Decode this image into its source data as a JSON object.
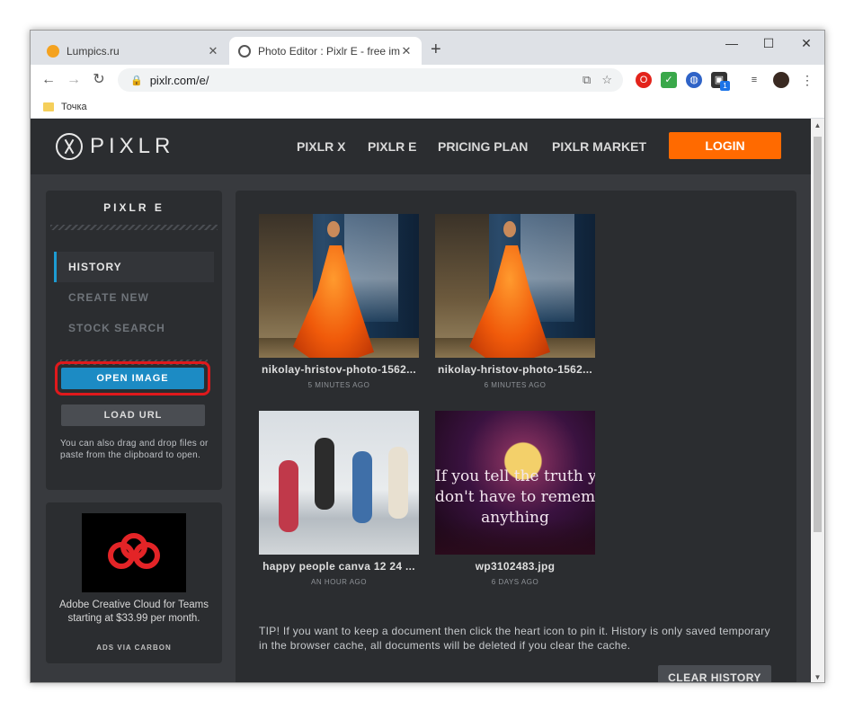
{
  "browser": {
    "tabs": [
      {
        "title": "Lumpics.ru",
        "active": false
      },
      {
        "title": "Photo Editor : Pixlr E - free image",
        "active": true
      }
    ],
    "address": "pixlr.com/e/",
    "bookmark": "Точка",
    "extension_badge": "1"
  },
  "header": {
    "logo": "PIXLR",
    "nav": [
      "PIXLR X",
      "PIXLR E",
      "PRICING PLAN",
      "PIXLR MARKET"
    ],
    "login": "LOGIN"
  },
  "sidebar": {
    "title": "PIXLR E",
    "items": [
      {
        "label": "HISTORY",
        "active": true
      },
      {
        "label": "CREATE NEW",
        "active": false
      },
      {
        "label": "STOCK SEARCH",
        "active": false
      }
    ],
    "open_image": "OPEN IMAGE",
    "load_url": "LOAD URL",
    "drag_note": "You can also drag and drop files or paste from the clipboard to open."
  },
  "ad": {
    "text": "Adobe Creative Cloud for Teams starting at $33.99 per month.",
    "via": "ADS VIA CARBON"
  },
  "history": [
    {
      "name": "nikolay-hristov-photo-1562...",
      "time": "5 MINUTES AGO"
    },
    {
      "name": "nikolay-hristov-photo-1562...",
      "time": "6 MINUTES AGO"
    },
    {
      "name": "happy people canva 12 24 ...",
      "time": "AN HOUR AGO"
    },
    {
      "name": "wp3102483.jpg",
      "time": "6 DAYS AGO",
      "quote": [
        "If you tell the truth you",
        "don't have to remember",
        "anything"
      ]
    }
  ],
  "tip": "TIP! If you want to keep a document then click the heart icon to pin it. History is only saved temporary in the browser cache, all documents will be deleted if you clear the cache.",
  "clear_history": "CLEAR HISTORY",
  "colors": {
    "accent": "#ff6a00",
    "primary_button": "#1c8bc4",
    "highlight": "#e0191c",
    "active_bar": "#1d9bd2"
  }
}
